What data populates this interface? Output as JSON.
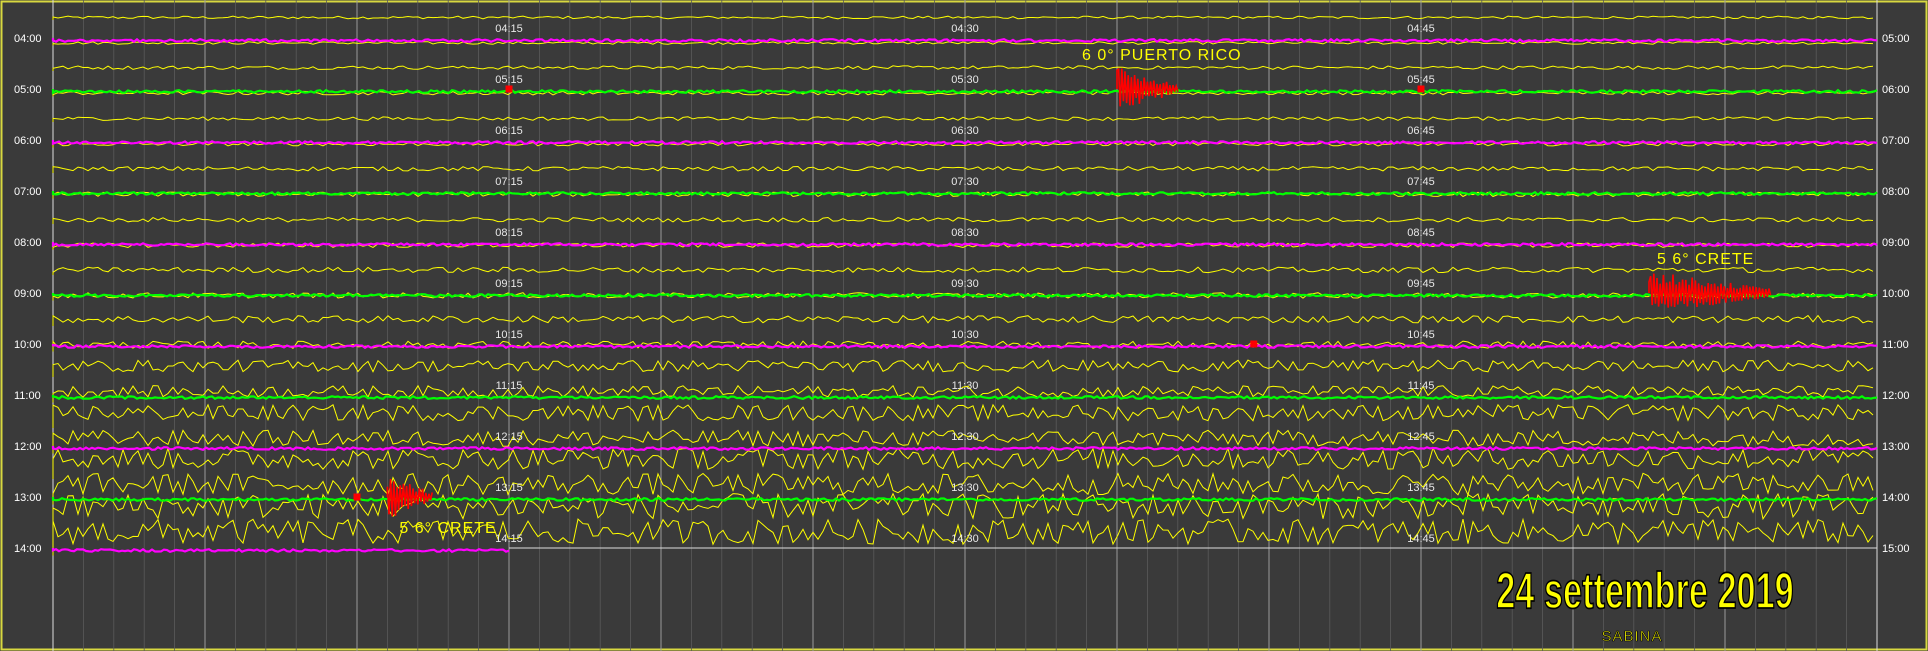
{
  "chart_data": {
    "type": "line",
    "title": "24 settembre 2019",
    "subtitle": "SABINA",
    "left_hour_labels": [
      "04:00",
      "05:00",
      "06:00",
      "07:00",
      "08:00",
      "09:00",
      "10:00",
      "11:00",
      "12:00",
      "13:00",
      "14:00"
    ],
    "right_hour_labels": [
      "05:00",
      "06:00",
      "07:00",
      "08:00",
      "09:00",
      "10:00",
      "11:00",
      "12:00",
      "13:00",
      "14:00",
      "15:00"
    ],
    "minute_labels": [
      [
        "04:15",
        "04:30",
        "04:45"
      ],
      [
        "05:15",
        "05:30",
        "05:45"
      ],
      [
        "06:15",
        "06:30",
        "06:45"
      ],
      [
        "07:15",
        "07:30",
        "07:45"
      ],
      [
        "08:15",
        "08:30",
        "08:45"
      ],
      [
        "09:15",
        "09:30",
        "09:45"
      ],
      [
        "10:15",
        "10:30",
        "10:45"
      ],
      [
        "11:15",
        "11:30",
        "11:45"
      ],
      [
        "12:15",
        "12:30",
        "12:45"
      ],
      [
        "13:15",
        "13:30",
        "13:45"
      ],
      [
        "14:15",
        "14:30",
        "14:45"
      ]
    ],
    "x_unit": "minutes past the hour",
    "xlim": [
      0,
      60
    ],
    "line_colors": [
      "#ff00ff",
      "#00ff00"
    ],
    "trace_color": "#ffff00",
    "event_color": "#ff0000",
    "background": "#3a3a3a",
    "grid": true,
    "last_line_end_minute": 15,
    "small_event_marks": [
      {
        "hour": "05:00",
        "minute": 15
      },
      {
        "hour": "05:00",
        "minute": 45
      },
      {
        "hour": "10:00",
        "minute": 39.5
      },
      {
        "hour": "13:00",
        "minute": 10
      }
    ],
    "events": [
      {
        "label": "6 0° PUERTO RICO",
        "hour": "05:00",
        "minute": 35,
        "duration": 2
      },
      {
        "label": "5 6° CRETE",
        "hour": "09:00",
        "minute": 52.5,
        "duration": 4
      },
      {
        "label": "5 6° CRETE",
        "hour": "13:00",
        "minute": 11,
        "duration": 1.5
      }
    ]
  }
}
